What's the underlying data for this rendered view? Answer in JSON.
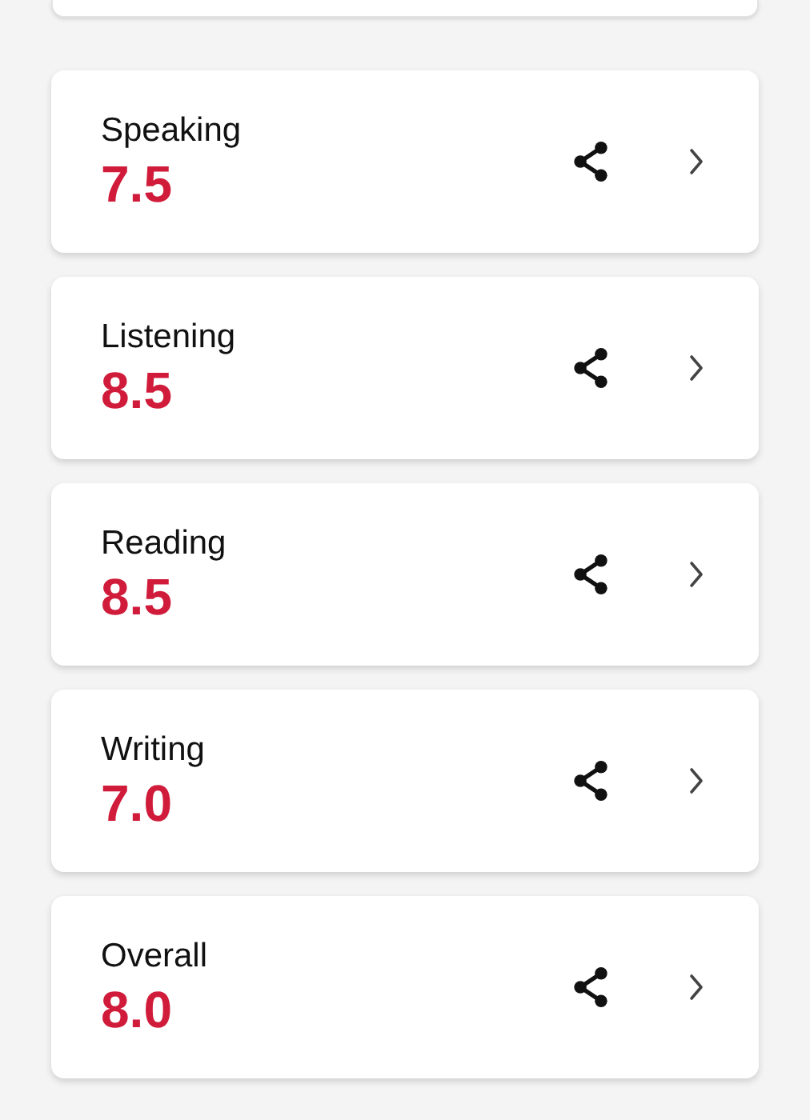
{
  "scores": [
    {
      "label": "Speaking",
      "score": "7.5"
    },
    {
      "label": "Listening",
      "score": "8.5"
    },
    {
      "label": "Reading",
      "score": "8.5"
    },
    {
      "label": "Writing",
      "score": "7.0"
    },
    {
      "label": "Overall",
      "score": "8.0"
    }
  ]
}
